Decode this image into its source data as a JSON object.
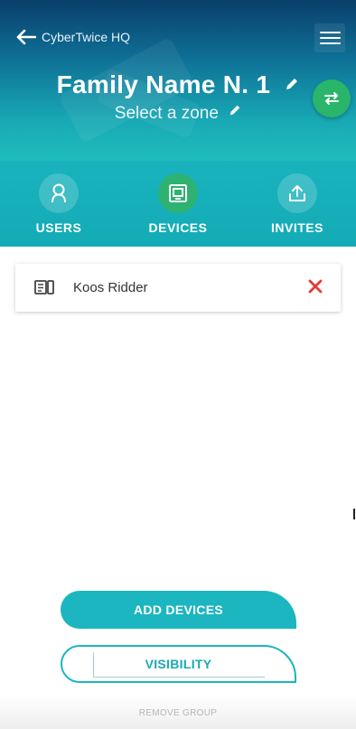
{
  "header": {
    "back_label": "CyberTwice HQ",
    "title": "Family Name N. 1",
    "zone_label": "Select a zone",
    "icons": {
      "back": "arrow-left-icon",
      "menu": "hamburger-menu-icon",
      "edit": "pencil-icon",
      "swap": "swap-arrows-icon"
    }
  },
  "tabs": [
    {
      "label": "USERS",
      "icon": "user-icon",
      "active": false
    },
    {
      "label": "DEVICES",
      "icon": "devices-icon",
      "active": true
    },
    {
      "label": "INVITES",
      "icon": "share-upload-icon",
      "active": false
    }
  ],
  "devices": [
    {
      "name": "Koos Ridder",
      "icon": "device-book-icon",
      "remove_icon": "close-x-icon"
    }
  ],
  "actions": {
    "add_devices": "ADD DEVICES",
    "visibility": "VISIBILITY",
    "remove_group": "REMOVE GROUP"
  },
  "colors": {
    "accent": "#1bb6bf",
    "active_tab": "#2eb272",
    "swap_button": "#29b56a",
    "remove": "#e53935",
    "header_top": "#0a3f6b"
  }
}
